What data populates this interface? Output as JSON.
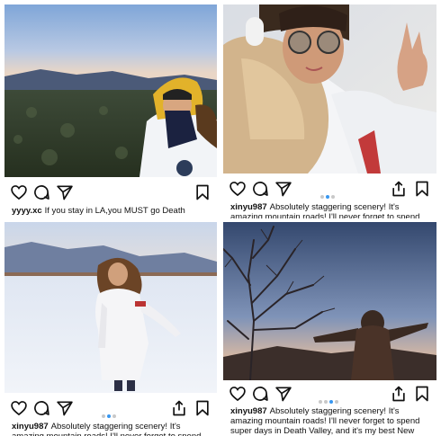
{
  "posts": [
    {
      "username": "yyyy.xc",
      "caption": "If you stay in LA,you MUST go Death Valley."
    },
    {
      "username": "xinyu987",
      "caption": "Absolutely staggering scenery!  It's amazing mountain roads! I'll never forget to spend"
    },
    {
      "username": "xinyu987",
      "caption": "Absolutely staggering scenery!  It's amazing mountain roads! I'll never forget to spend"
    },
    {
      "username": "xinyu987",
      "caption": "Absolutely staggering scenery!  It's amazing mountain roads! I'll never forget to spend super days in Death Valley, and it's my best New"
    }
  ],
  "icons": {
    "like": "heart-icon",
    "comment": "comment-icon",
    "share": "send-icon",
    "save": "bookmark-icon",
    "export": "share-icon"
  },
  "colors": {
    "active_dot": "#3897f0",
    "inactive_dot": "#c8c8c8"
  }
}
